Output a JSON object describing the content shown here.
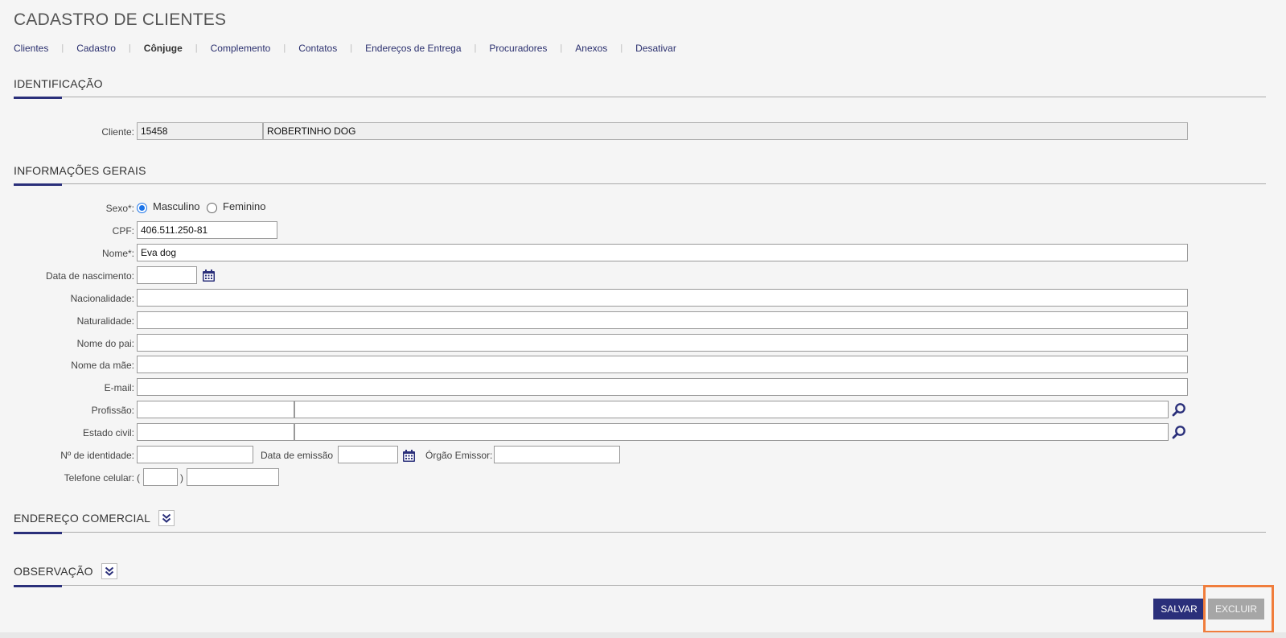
{
  "page": {
    "title": "CADASTRO DE CLIENTES"
  },
  "tabs": [
    {
      "label": "Clientes",
      "active": false
    },
    {
      "label": "Cadastro",
      "active": false
    },
    {
      "label": "Cônjuge",
      "active": true
    },
    {
      "label": "Complemento",
      "active": false
    },
    {
      "label": "Contatos",
      "active": false
    },
    {
      "label": "Endereços de Entrega",
      "active": false
    },
    {
      "label": "Procuradores",
      "active": false
    },
    {
      "label": "Anexos",
      "active": false
    },
    {
      "label": "Desativar",
      "active": false
    }
  ],
  "identificacao": {
    "title": "IDENTIFICAÇÃO",
    "cliente_label": "Cliente:",
    "cliente_code": "15458",
    "cliente_name": "ROBERTINHO DOG"
  },
  "informacoes": {
    "title": "INFORMAÇÕES GERAIS",
    "sexo_label": "Sexo*:",
    "sexo_options": [
      "Masculino",
      "Feminino"
    ],
    "sexo_selected": "Masculino",
    "cpf_label": "CPF:",
    "cpf_value": "406.511.250-81",
    "nome_label": "Nome*:",
    "nome_value": "Eva dog",
    "nascimento_label": "Data de nascimento:",
    "nacionalidade_label": "Nacionalidade:",
    "naturalidade_label": "Naturalidade:",
    "pai_label": "Nome do pai:",
    "mae_label": "Nome da mãe:",
    "email_label": "E-mail:",
    "profissao_label": "Profissão:",
    "estado_civil_label": "Estado civil:",
    "identidade_label": "Nº de identidade:",
    "emissao_label": "Data de emissão",
    "orgao_label": "Órgão Emissor:",
    "celular_label": "Telefone celular:",
    "paren_open": "(",
    "paren_close": ")"
  },
  "endereco_comercial": {
    "title": "ENDEREÇO COMERCIAL"
  },
  "observacao": {
    "title": "OBSERVAÇÃO"
  },
  "actions": {
    "save_label": "SALVAR",
    "delete_label": "EXCLUIR"
  },
  "colors": {
    "accent": "#2a2f7a",
    "highlight": "#f07d3c",
    "radio": "#1a73e8"
  },
  "icons": {
    "calendar": "calendar-icon",
    "search": "search-icon",
    "expand": "chevron-double-down-icon"
  }
}
